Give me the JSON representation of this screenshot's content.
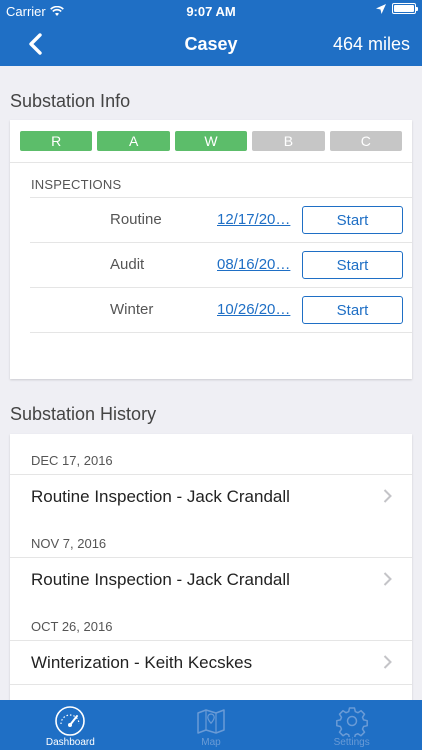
{
  "status_bar": {
    "carrier": "Carrier",
    "time": "9:07 AM"
  },
  "nav": {
    "title": "Casey",
    "miles": "464 miles"
  },
  "info": {
    "section_title": "Substation Info",
    "statuses": [
      {
        "label": "R",
        "active": true
      },
      {
        "label": "A",
        "active": true
      },
      {
        "label": "W",
        "active": true
      },
      {
        "label": "B",
        "active": false
      },
      {
        "label": "C",
        "active": false
      }
    ],
    "inspections_header": "INSPECTIONS",
    "inspections": [
      {
        "name": "Routine",
        "date": "12/17/20…",
        "action": "Start"
      },
      {
        "name": "Audit",
        "date": "08/16/20…",
        "action": "Start"
      },
      {
        "name": "Winter",
        "date": "10/26/20…",
        "action": "Start"
      }
    ]
  },
  "history": {
    "section_title": "Substation History",
    "entries": [
      {
        "date": "DEC 17, 2016",
        "title": "Routine Inspection - Jack Crandall"
      },
      {
        "date": "NOV 7, 2016",
        "title": "Routine Inspection - Jack Crandall"
      },
      {
        "date": "OCT 26, 2016",
        "title": "Winterization - Keith Kecskes"
      }
    ]
  },
  "tabs": [
    {
      "label": "Dashboard",
      "icon": "dashboard-icon",
      "active": true
    },
    {
      "label": "Map",
      "icon": "map-icon",
      "active": false
    },
    {
      "label": "Settings",
      "icon": "gear-icon",
      "active": false
    }
  ],
  "colors": {
    "primary": "#1f6fc5",
    "status_on": "#5cbd6a",
    "status_off": "#c6c6c6",
    "background": "#efeff4"
  }
}
